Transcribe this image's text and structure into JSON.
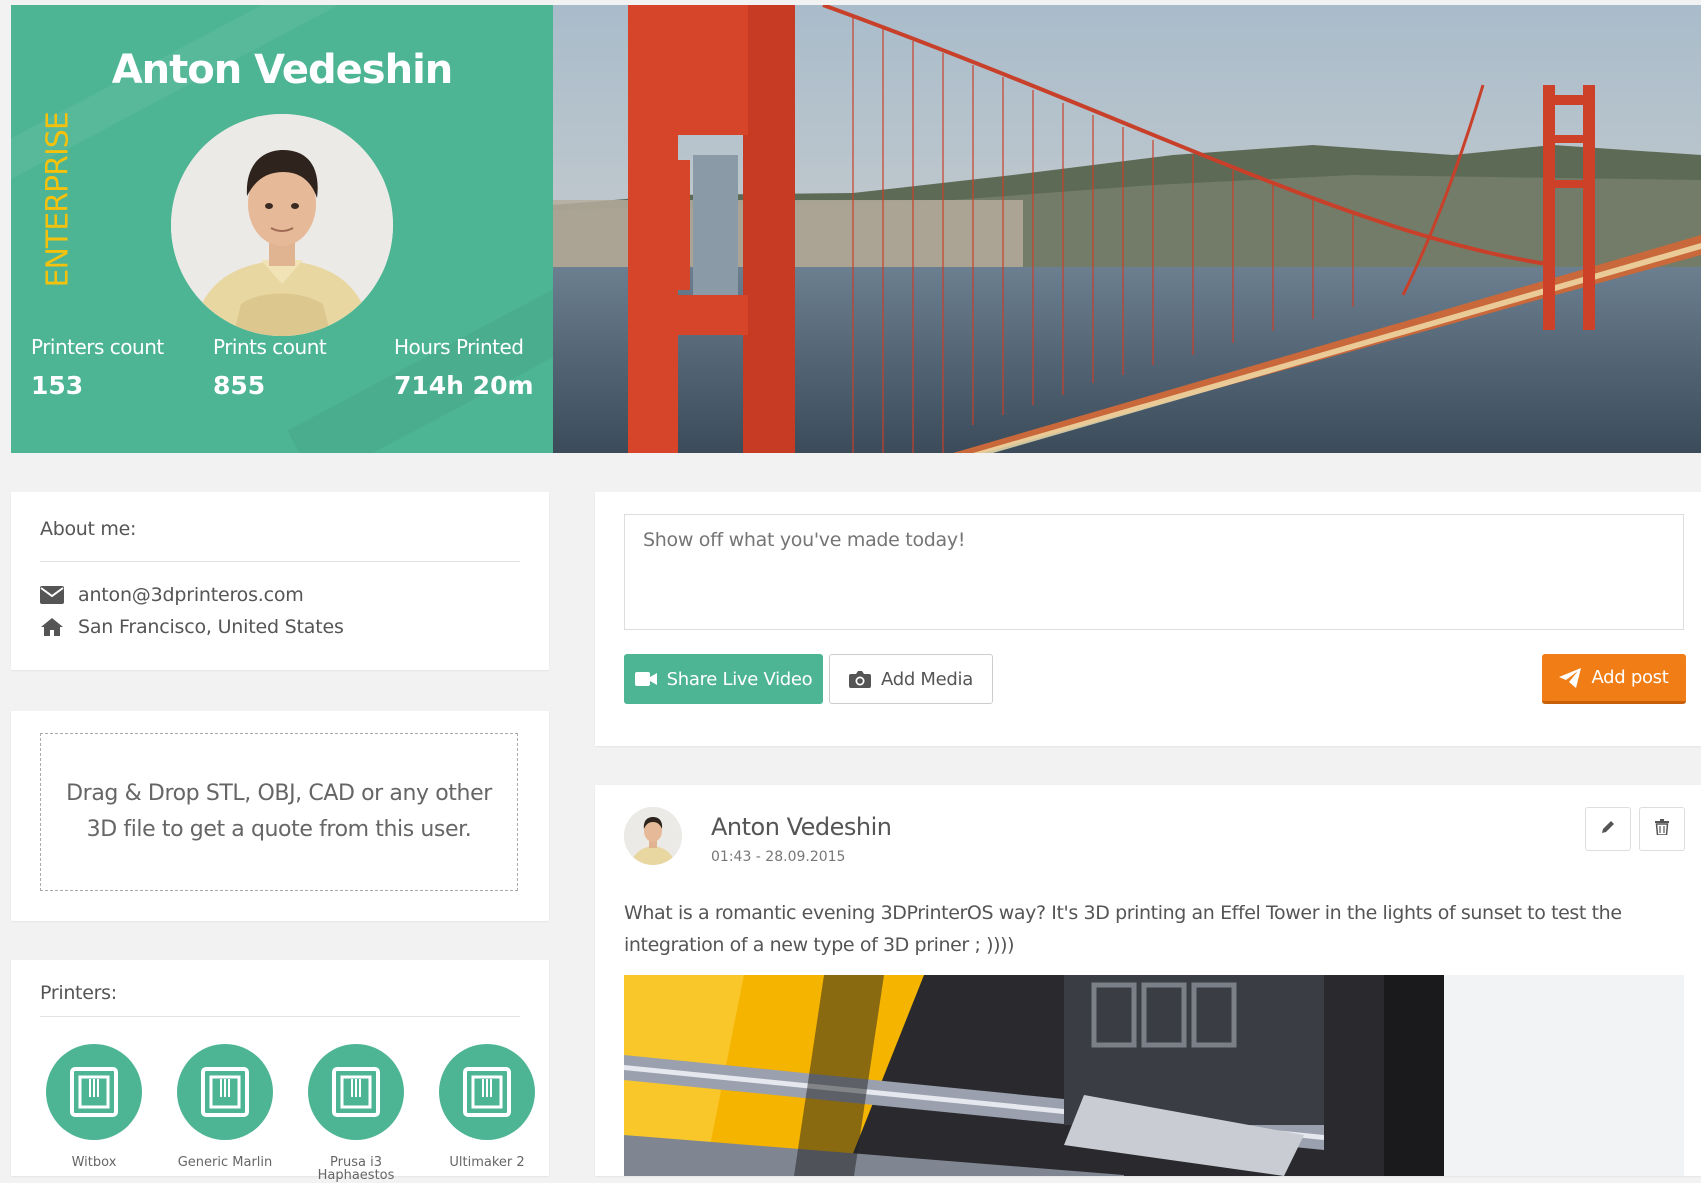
{
  "profile": {
    "name": "Anton Vedeshin",
    "plan_badge": "ENTERPRISE",
    "stats": [
      {
        "label": "Printers count",
        "value": "153"
      },
      {
        "label": "Prints count",
        "value": "855"
      },
      {
        "label": "Hours Printed",
        "value": "714h 20m"
      }
    ]
  },
  "about": {
    "title": "About me:",
    "email": "anton@3dprinteros.com",
    "location": "San Francisco, United States",
    "email_icon": "envelope-icon",
    "location_icon": "home-icon"
  },
  "dropzone": {
    "text": "Drag & Drop STL, OBJ, CAD or any other 3D file to get a quote from this user."
  },
  "printers": {
    "title": "Printers:",
    "items": [
      {
        "name": "Witbox"
      },
      {
        "name": "Generic Marlin"
      },
      {
        "name": "Prusa i3 Haphaestos"
      },
      {
        "name": "Ultimaker 2"
      }
    ]
  },
  "composer": {
    "placeholder": "Show off what you've made today!",
    "share_live_label": "Share Live Video",
    "add_media_label": "Add Media",
    "add_post_label": "Add post"
  },
  "post": {
    "author": "Anton Vedeshin",
    "date": "01:43 - 28.09.2015",
    "text": "What is a romantic evening 3DPrinterOS way?  It's 3D printing an Effel Tower in the lights of sunset to test the integration of a new type of 3D priner ; ))))"
  },
  "colors": {
    "accent": "#4db594",
    "badge": "#f4c20d",
    "post_button": "#f07d16"
  }
}
